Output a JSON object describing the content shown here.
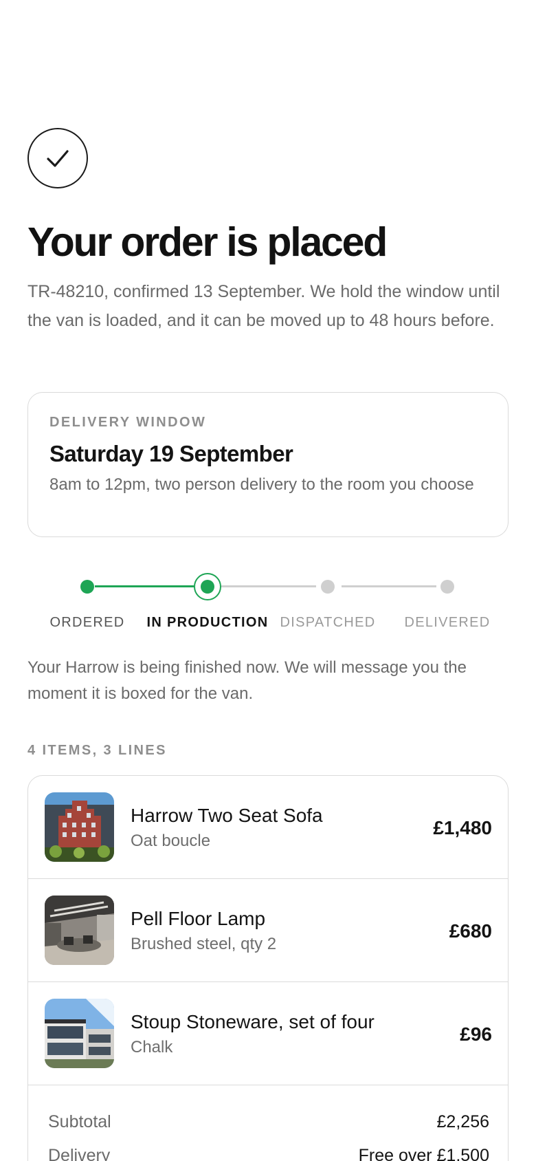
{
  "confirmation": {
    "icon": "checkmark-icon",
    "title": "Your order is placed",
    "intro": "TR-48210, confirmed 13 September. We hold the window until the van is loaded, and it can be moved up to 48 hours before."
  },
  "delivery_window": {
    "label": "DELIVERY WINDOW",
    "date": "Saturday 19 September",
    "description": "8am to 12pm, two person delivery to the room you choose"
  },
  "progress": {
    "steps": [
      {
        "label": "ORDERED",
        "state": "complete"
      },
      {
        "label": "IN PRODUCTION",
        "state": "current"
      },
      {
        "label": "DISPATCHED",
        "state": "upcoming"
      },
      {
        "label": "DELIVERED",
        "state": "upcoming"
      }
    ],
    "message": "Your Harrow is being finished now. We will message you the moment it is boxed for the van."
  },
  "items": {
    "heading": "4 ITEMS, 3 LINES",
    "lines": [
      {
        "name": "Harrow Two Seat Sofa",
        "variant": "Oat boucle",
        "price": "£1,480",
        "thumb": "brick-building-photo"
      },
      {
        "name": "Pell Floor Lamp",
        "variant": "Brushed steel, qty 2",
        "price": "£680",
        "thumb": "interior-room-photo"
      },
      {
        "name": "Stoup Stoneware, set of four",
        "variant": "Chalk",
        "price": "£96",
        "thumb": "modern-house-photo"
      }
    ]
  },
  "summary": {
    "subtotal_label": "Subtotal",
    "subtotal_value": "£2,256",
    "delivery_label": "Delivery",
    "delivery_value": "Free over £1,500"
  },
  "colors": {
    "accent": "#1ea555",
    "inactive": "#cfcfcf",
    "muted_text": "#6a6a6a",
    "border": "#dadada"
  }
}
